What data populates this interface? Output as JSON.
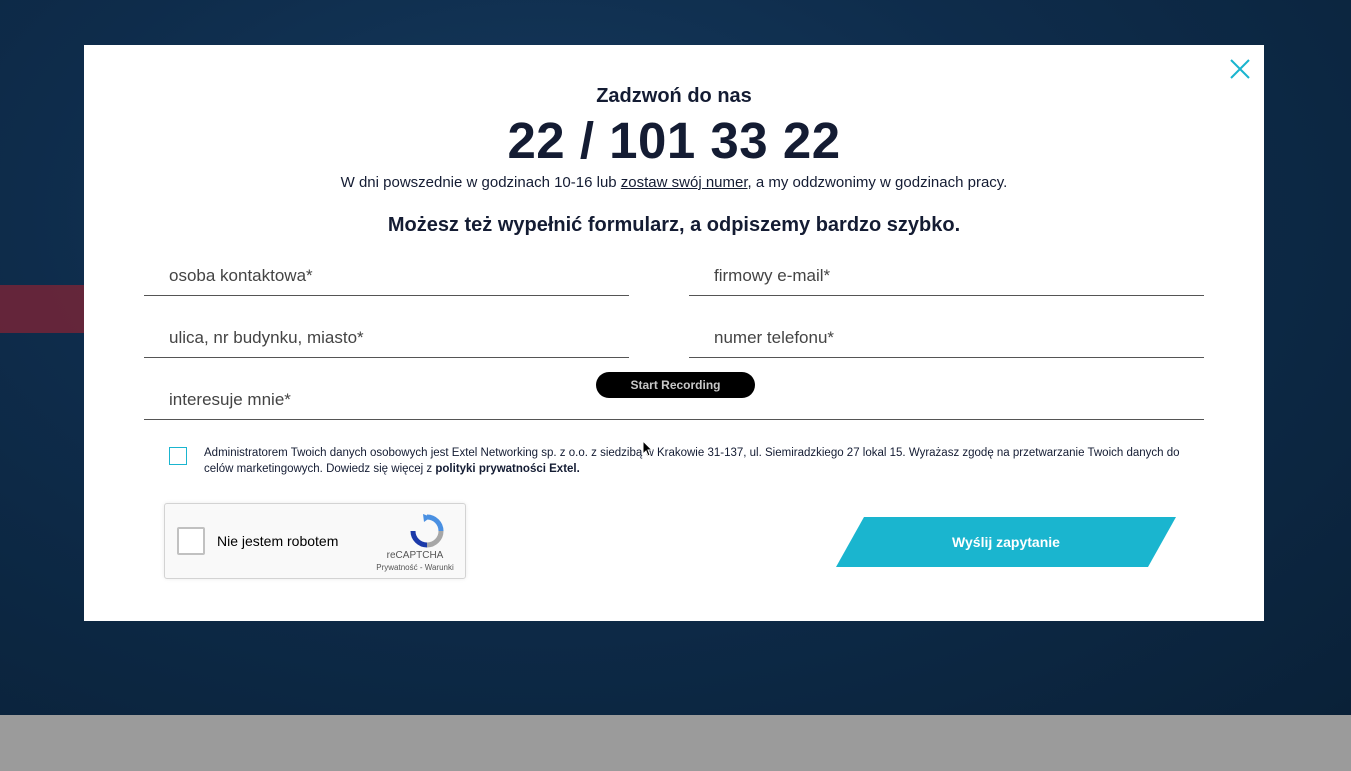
{
  "modal": {
    "call_label": "Zadzwoń do nas",
    "phone_number": "22 / 101 33 22",
    "hours_prefix": "W dni powszednie w godzinach 10-16 lub ",
    "hours_link": "zostaw swój numer",
    "hours_suffix": ", a my oddzwonimy w godzinach pracy.",
    "form_heading": "Możesz też wypełnić formularz, a odpiszemy bardzo szybko."
  },
  "form": {
    "contact_placeholder": "osoba kontaktowa*",
    "email_placeholder": "firmowy e-mail*",
    "address_placeholder": "ulica, nr budynku, miasto*",
    "phone_placeholder": "numer telefonu*",
    "interest_placeholder": "interesuje mnie*",
    "consent_text": "Administratorem Twoich danych osobowych jest Extel Networking sp. z o.o. z siedzibą w Krakowie 31-137, ul. Siemiradzkiego 27 lokal 15. Wyrażasz zgodę na przetwarzanie Twoich danych do celów marketingowych. Dowiedz się więcej z ",
    "consent_link": "polityki prywatności Extel.",
    "submit_label": "Wyślij zapytanie"
  },
  "recorder": {
    "label": "Start Recording"
  },
  "captcha": {
    "label": "Nie jestem robotem",
    "brand": "reCAPTCHA",
    "links": "Prywatność - Warunki"
  },
  "colors": {
    "accent": "#1ab5cf",
    "text_dark": "#141c33",
    "backdrop": "#0e2c4b"
  },
  "icons": {
    "close": "close-icon",
    "captcha": "recaptcha-logo-icon",
    "cursor": "mouse-cursor-icon"
  }
}
